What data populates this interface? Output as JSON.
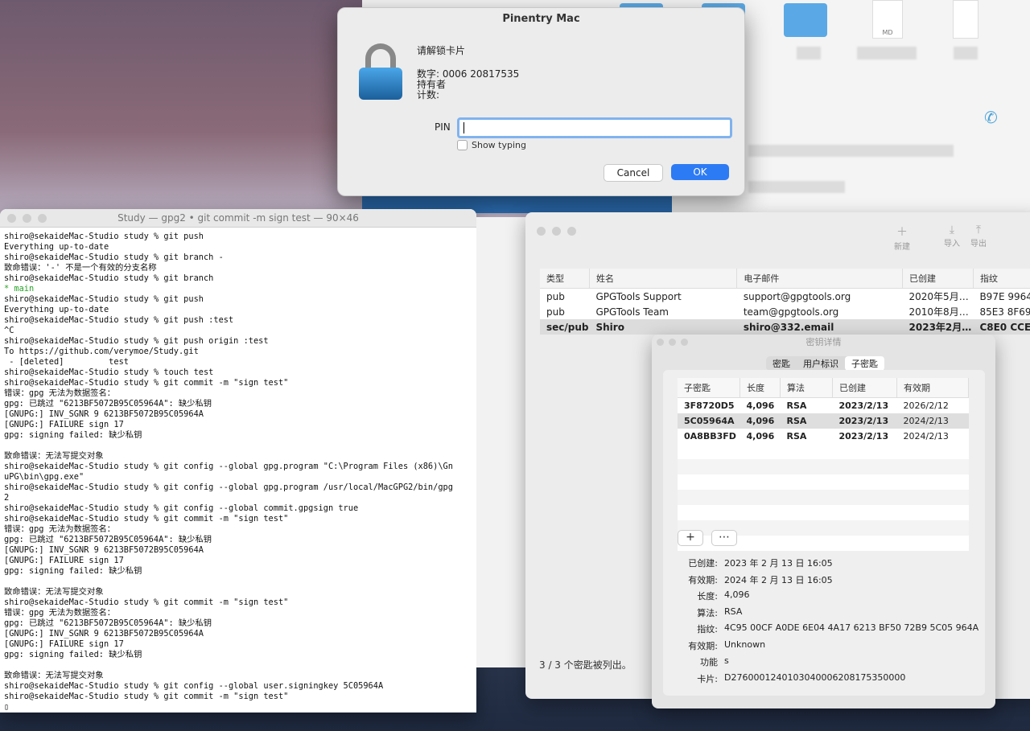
{
  "pinentry": {
    "title": "Pinentry Mac",
    "prompt": "请解锁卡片",
    "number_line": "数字: 0006 20817535",
    "holder_line": "持有者",
    "count_line": "计数:",
    "pin_label": "PIN",
    "pin_value": "",
    "show_typing": "Show typing",
    "cancel": "Cancel",
    "ok": "OK"
  },
  "terminal": {
    "title": "Study — gpg2 • git commit -m sign test — 90×46",
    "lines": [
      "shiro@sekaideMac-Studio study % git push",
      "Everything up-to-date",
      "shiro@sekaideMac-Studio study % git branch -",
      "致命错误：'-' 不是一个有效的分支名称",
      "shiro@sekaideMac-Studio study % git branch",
      "* main",
      "shiro@sekaideMac-Studio study % git push",
      "Everything up-to-date",
      "shiro@sekaideMac-Studio study % git push :test",
      "^C",
      "shiro@sekaideMac-Studio study % git push origin :test",
      "To https://github.com/verymoe/Study.git",
      " - [deleted]         test",
      "shiro@sekaideMac-Studio study % touch test",
      "shiro@sekaideMac-Studio study % git commit -m \"sign test\"",
      "错误：gpg 无法为数据签名：",
      "gpg: 已跳过 \"6213BF5072B95C05964A\": 缺少私钥",
      "[GNUPG:] INV_SGNR 9 6213BF5072B95C05964A",
      "[GNUPG:] FAILURE sign 17",
      "gpg: signing failed: 缺少私钥",
      "",
      "致命错误：无法写提交对象",
      "shiro@sekaideMac-Studio study % git config --global gpg.program \"C:\\Program Files (x86)\\Gn",
      "uPG\\bin\\gpg.exe\"",
      "shiro@sekaideMac-Studio study % git config --global gpg.program /usr/local/MacGPG2/bin/gpg",
      "2",
      "shiro@sekaideMac-Studio study % git config --global commit.gpgsign true",
      "shiro@sekaideMac-Studio study % git commit -m \"sign test\"",
      "错误：gpg 无法为数据签名：",
      "gpg: 已跳过 \"6213BF5072B95C05964A\": 缺少私钥",
      "[GNUPG:] INV_SGNR 9 6213BF5072B95C05964A",
      "[GNUPG:] FAILURE sign 17",
      "gpg: signing failed: 缺少私钥",
      "",
      "致命错误：无法写提交对象",
      "shiro@sekaideMac-Studio study % git commit -m \"sign test\"",
      "错误：gpg 无法为数据签名：",
      "gpg: 已跳过 \"6213BF5072B95C05964A\": 缺少私钥",
      "[GNUPG:] INV_SGNR 9 6213BF5072B95C05964A",
      "[GNUPG:] FAILURE sign 17",
      "gpg: signing failed: 缺少私钥",
      "",
      "致命错误：无法写提交对象",
      "shiro@sekaideMac-Studio study % git config --global user.signingkey 5C05964A",
      "shiro@sekaideMac-Studio study % git commit -m \"sign test\"",
      "▯"
    ]
  },
  "finder": {
    "doc_label": "MD"
  },
  "keychain": {
    "toolbar": [
      "新建",
      "导入",
      "导出"
    ],
    "columns": [
      "类型",
      "姓名",
      "电子邮件",
      "已创建",
      "指纹"
    ],
    "rows": [
      {
        "type": "pub",
        "name": "GPGTools Support",
        "email": "support@gpgtools.org",
        "created": "2020年5月…",
        "fp": "B97E 9964"
      },
      {
        "type": "pub",
        "name": "GPGTools Team",
        "email": "team@gpgtools.org",
        "created": "2010年8月…",
        "fp": "85E3 8F69"
      },
      {
        "type": "sec/pub",
        "name": "Shiro",
        "email": "shiro@332.email",
        "created": "2023年2月…",
        "fp": "C8E0 CCE2"
      }
    ],
    "footer": "3 / 3 个密匙被列出。"
  },
  "keydetail": {
    "title": "密钥详情",
    "tabs": [
      "密匙",
      "用户标识",
      "子密匙"
    ],
    "columns": [
      "子密匙",
      "长度",
      "算法",
      "已创建",
      "有效期"
    ],
    "subkeys": [
      {
        "id": "3F8720D5",
        "len": "4,096",
        "algo": "RSA",
        "created": "2023/2/13",
        "expires": "2026/2/12"
      },
      {
        "id": "5C05964A",
        "len": "4,096",
        "algo": "RSA",
        "created": "2023/2/13",
        "expires": "2024/2/13"
      },
      {
        "id": "0A8BB3FD",
        "len": "4,096",
        "algo": "RSA",
        "created": "2023/2/13",
        "expires": "2024/2/13"
      }
    ],
    "add": "+",
    "more": "⋯",
    "details": [
      {
        "k": "已创建:",
        "v": "2023 年 2 月 13 日 16:05"
      },
      {
        "k": "有效期:",
        "v": "2024 年 2 月 13 日 16:05"
      },
      {
        "k": "长度:",
        "v": "4,096"
      },
      {
        "k": "算法:",
        "v": "RSA"
      },
      {
        "k": "指纹:",
        "v": "4C95 00CF A0DE 6E04 4A17  6213 BF50 72B9 5C05 964A"
      },
      {
        "k": "有效期:",
        "v": "Unknown"
      },
      {
        "k": "功能",
        "v": "s"
      },
      {
        "k": "卡片:",
        "v": "D2760001240103040006208175350000"
      }
    ]
  }
}
